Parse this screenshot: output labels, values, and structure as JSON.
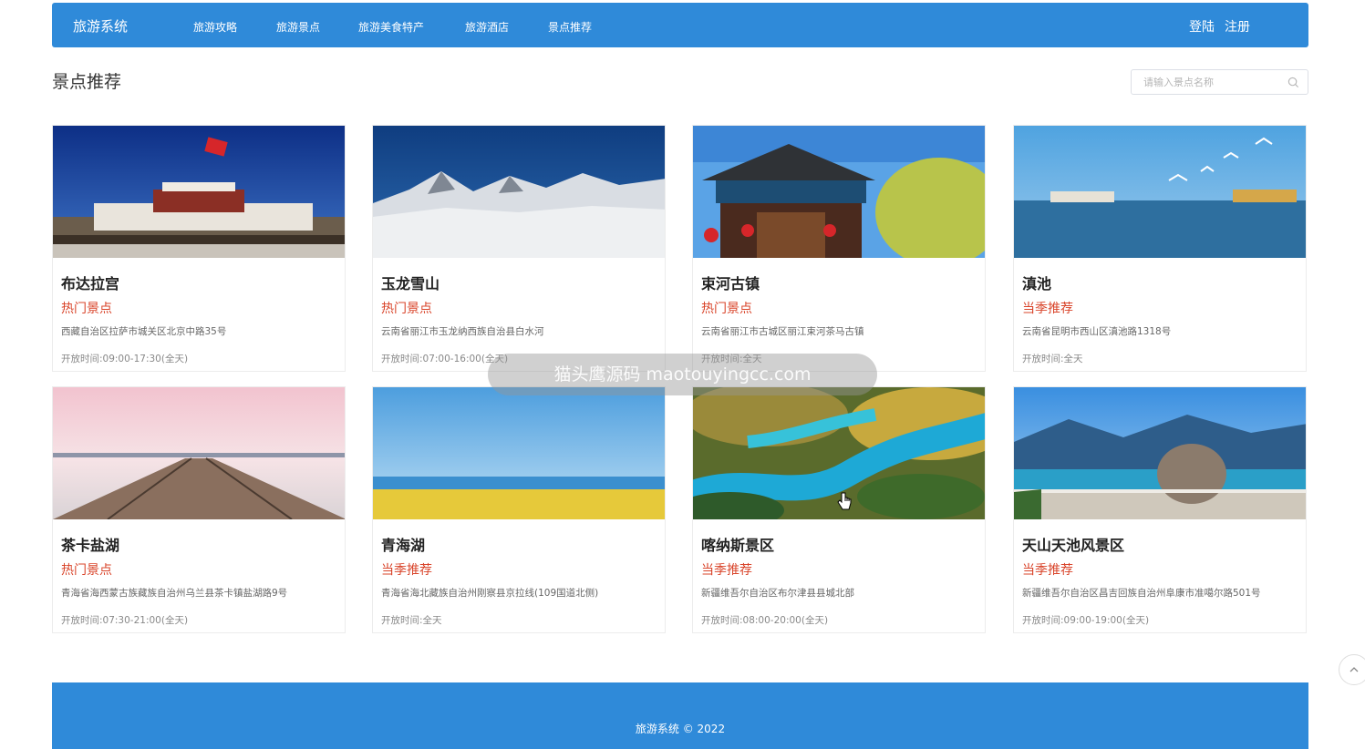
{
  "header": {
    "brand": "旅游系统",
    "nav": [
      "旅游攻略",
      "旅游景点",
      "旅游美食特产",
      "旅游酒店",
      "景点推荐"
    ],
    "login": "登陆",
    "register": "注册"
  },
  "page": {
    "title": "景点推荐",
    "search_placeholder": "请输入景点名称"
  },
  "cards": [
    {
      "name": "布达拉宫",
      "tag": "热门景点",
      "address": "西藏自治区拉萨市城关区北京中路35号",
      "hours": "开放时间:09:00-17:30(全天)"
    },
    {
      "name": "玉龙雪山",
      "tag": "热门景点",
      "address": "云南省丽江市玉龙纳西族自治县白水河",
      "hours": "开放时间:07:00-16:00(全天)"
    },
    {
      "name": "束河古镇",
      "tag": "热门景点",
      "address": "云南省丽江市古城区丽江束河茶马古镇",
      "hours": "开放时间:全天"
    },
    {
      "name": "滇池",
      "tag": "当季推荐",
      "address": "云南省昆明市西山区滇池路1318号",
      "hours": "开放时间:全天"
    },
    {
      "name": "茶卡盐湖",
      "tag": "热门景点",
      "address": "青海省海西蒙古族藏族自治州乌兰县茶卡镇盐湖路9号",
      "hours": "开放时间:07:30-21:00(全天)"
    },
    {
      "name": "青海湖",
      "tag": "当季推荐",
      "address": "青海省海北藏族自治州刚察县京拉线(109国道北侧)",
      "hours": "开放时间:全天"
    },
    {
      "name": "喀纳斯景区",
      "tag": "当季推荐",
      "address": "新疆维吾尔自治区布尔津县县城北部",
      "hours": "开放时间:08:00-20:00(全天)"
    },
    {
      "name": "天山天池风景区",
      "tag": "当季推荐",
      "address": "新疆维吾尔自治区昌吉回族自治州阜康市准噶尔路501号",
      "hours": "开放时间:09:00-19:00(全天)"
    }
  ],
  "watermark": "猫头鹰源码 maotouyingcc.com",
  "footer": {
    "copyright": "旅游系统 © 2022"
  },
  "colors": {
    "primary": "#2f8ad9",
    "tag_red": "#d9442a"
  }
}
